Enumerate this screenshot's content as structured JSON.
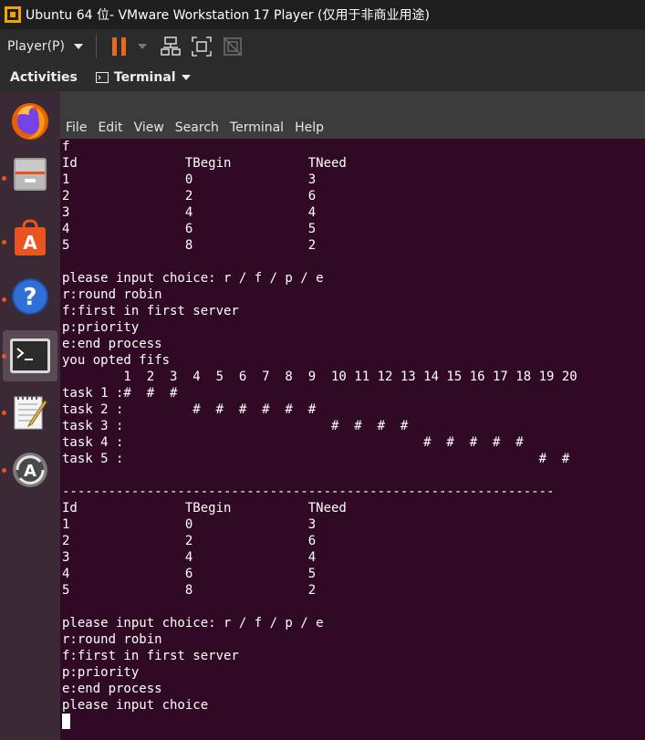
{
  "window": {
    "title": "Ubuntu 64 位- VMware Workstation 17 Player (仅用于非商业用途)"
  },
  "toolbar": {
    "player_menu": "Player(P)"
  },
  "topbar": {
    "activities": "Activities",
    "app_menu": "Terminal"
  },
  "dock": {
    "items": [
      "firefox-icon",
      "files-icon",
      "software-icon",
      "help-icon",
      "terminal-icon",
      "text-editor-icon",
      "software-updater-icon"
    ],
    "colors": {
      "accent": "#e95420",
      "dock_bg": "#3a2a35"
    }
  },
  "terminal": {
    "menu": [
      "File",
      "Edit",
      "View",
      "Search",
      "Terminal",
      "Help"
    ],
    "lines": [
      "f",
      "Id              TBegin          TNeed",
      "1               0               3",
      "2               2               6",
      "3               4               4",
      "4               6               5",
      "5               8               2",
      "",
      "please input choice: r / f / p / e",
      "r:round robin",
      "f:first in first server",
      "p:priority",
      "e:end process",
      "you opted fifs",
      "        1  2  3  4  5  6  7  8  9  10 11 12 13 14 15 16 17 18 19 20",
      "task 1 :#  #  #",
      "task 2 :         #  #  #  #  #  #",
      "task 3 :                           #  #  #  #",
      "task 4 :                                       #  #  #  #  #",
      "task 5 :                                                      #  #",
      "",
      "----------------------------------------------------------------",
      "Id              TBegin          TNeed",
      "1               0               3",
      "2               2               6",
      "3               4               4",
      "4               6               5",
      "5               8               2",
      "",
      "please input choice: r / f / p / e",
      "r:round robin",
      "f:first in first server",
      "p:priority",
      "e:end process",
      "please input choice"
    ],
    "colors": {
      "background": "#300a24",
      "foreground": "#ffffff"
    }
  }
}
